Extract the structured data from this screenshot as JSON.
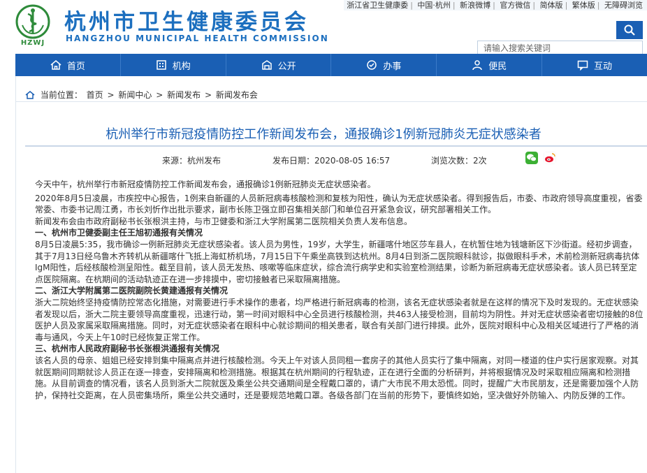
{
  "header": {
    "site_title": "杭州市卫生健康委员会",
    "site_subtitle": "HANGZHOU MUNICIPAL HEALTH COMMISSION",
    "logo_text": "HZWJ",
    "top_links": [
      "浙江省卫生健康委",
      "中国·杭州",
      "新浪微博",
      "官方微信",
      "简体版",
      "繁体版",
      "无障碍浏览"
    ],
    "search_placeholder": "请输入搜索关键词"
  },
  "nav": {
    "items": [
      {
        "label": "首页",
        "icon": "home-icon"
      },
      {
        "label": "机构",
        "icon": "building-icon"
      },
      {
        "label": "公开",
        "icon": "open-icon"
      },
      {
        "label": "办事",
        "icon": "service-icon"
      },
      {
        "label": "便民",
        "icon": "people-icon"
      },
      {
        "label": "互动",
        "icon": "interact-icon"
      }
    ]
  },
  "breadcrumb": {
    "prefix": "当前位置：",
    "items": [
      "首页",
      "新闻中心",
      "新闻发布",
      "新闻发布会"
    ],
    "separator": ">"
  },
  "article": {
    "title": "杭州举行市新冠疫情防控工作新闻发布会，通报确诊1例新冠肺炎无症状感染者",
    "source_label": "来源：",
    "source": "杭州发布",
    "date_label": "发布日期：",
    "date": "2020-08-05 16:57",
    "views_label": "浏览次数：",
    "views": "2次",
    "paragraphs": [
      {
        "type": "lead",
        "text": "今天中午，杭州举行市新冠疫情防控工作新闻发布会，通报确诊1例新冠肺炎无症状感染者。"
      },
      {
        "type": "p",
        "text": "2020年8月5日凌晨，市疾控中心报告，1例来自新疆的人员新冠病毒核酸检测和复核为阳性，确认为无症状感染者。得到报告后，市委、市政府领导高度重视，省委常委、市委书记周江勇，市长刘忻作出批示要求，副市长陈卫强立即召集相关部门和单位召开紧急会议，研究部署相关工作。"
      },
      {
        "type": "p",
        "text": "新闻发布会由市政府副秘书长张根洪主持，与市卫健委和浙江大学附属第二医院相关负责人发布信息。"
      },
      {
        "type": "h",
        "text": "一、杭州市卫健委副主任王旭初通报有关情况"
      },
      {
        "type": "p",
        "text": "8月5日凌晨5:35，我市确诊一例新冠肺炎无症状感染者。该人员为男性，19岁，大学生，新疆喀什地区莎车县人，在杭暂住地为钱塘新区下沙街道。经初步调查，其于7月13日经乌鲁木齐转机从新疆喀什飞抵上海虹桥机场，7月15日下午乘坐高铁到达杭州。8月4日到浙二医院眼科就诊，拟做眼科手术，术前检测新冠病毒抗体IgM阳性，后经核酸检测呈阳性。截至目前，该人员无发热、咳嗽等临床症状，综合流行病学史和实验室检测结果，诊断为新冠病毒无症状感染者。该人员已转至定点医院隔离。在杭期间的活动轨迹正在进一步排摸中，密切接触者已采取隔离措施。"
      },
      {
        "type": "h",
        "text": "二、浙江大学附属第二医院副院长黄建通报有关情况"
      },
      {
        "type": "p",
        "text": "浙大二院始终坚持疫情防控常态化措施，对需要进行手术操作的患者，均严格进行新冠病毒的检测，该名无症状感染者就是在这样的情况下及时发现的。无症状感染者发现以后，浙大二院主要领导高度重视，迅速行动，第一时间对眼科中心全员进行核酸检测，共463人接受检测，目前均为阴性。并对无症状感染者密切接触的8位医护人员及家属采取隔离措施。同时，对无症状感染者在眼科中心就诊期间的相关患者，联合有关部门进行排摸。此外，医院对眼科中心及相关区域进行了严格的消毒与通风，今天上午10时已经恢复正常工作。"
      },
      {
        "type": "h",
        "text": "三、杭州市人民政府副秘书长张根洪通报有关情况"
      },
      {
        "type": "p",
        "text": "该名人员的母亲、姐姐已经安排到集中隔离点并进行核酸检测。今天上午对该人员同租一套房子的其他人员实行了集中隔离，对同一楼道的住户实行居家观察。对其就医期间同期就诊人员正在逐一排查，安排隔离和检测措施。根据其在杭州期间的行程轨迹，正在进行全面的分析研判，并将根据情况及时采取相应隔离和检测措施。从目前调查的情况看，该名人员到浙大二院就医及乘坐公共交通期间是全程戴口罩的，请广大市民不用太恐慌。同时，提醒广大市民朋友，还是需要加强个人防护，保持社交距离，在人员密集场所，乘坐公共交通时，还是要规范地戴口罩。各级各部门在当前的形势下，要慎终如始，坚决做好外防输入、内防反弹的工作。"
      }
    ]
  },
  "colors": {
    "brand_blue": "#1a5fb4",
    "title_blue": "#1c6fbf",
    "logo_green": "#2e8b3a",
    "wechat_green": "#3cb034",
    "weibo_orange": "#f0a020"
  }
}
